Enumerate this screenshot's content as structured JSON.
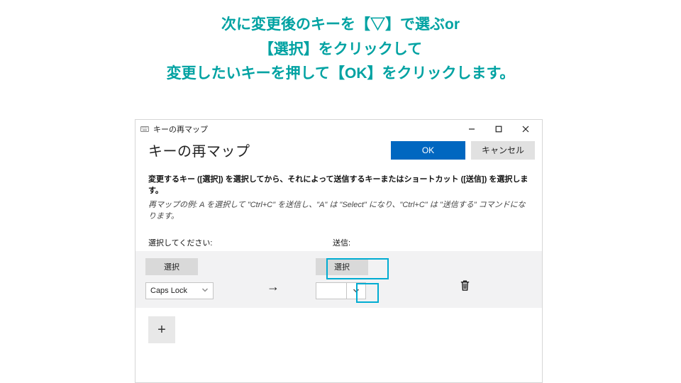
{
  "caption": {
    "line1": "次に変更後のキーを【▽】で選ぶor",
    "line2": "【選択】をクリックして",
    "line3": "変更したいキーを押して【OK】をクリックします。"
  },
  "window": {
    "title": "キーの再マップ",
    "page_title": "キーの再マップ",
    "ok_label": "OK",
    "cancel_label": "キャンセル",
    "instr1": "変更するキー ([選択]) を選択してから、それによって送信するキーまたはショートカット ([送信]) を選択します。",
    "instr2": "再マップの例: A を選択して \"Ctrl+C\" を送信し、\"A\" は \"Select\" になり、\"Ctrl+C\" は \"送信する\" コマンドになります。",
    "from_header": "選択してください:",
    "to_header": "送信:",
    "select_btn_label": "選択",
    "from_dd_value": "Caps Lock",
    "to_dd_value": "",
    "arrow": "→",
    "add_label": "+"
  }
}
